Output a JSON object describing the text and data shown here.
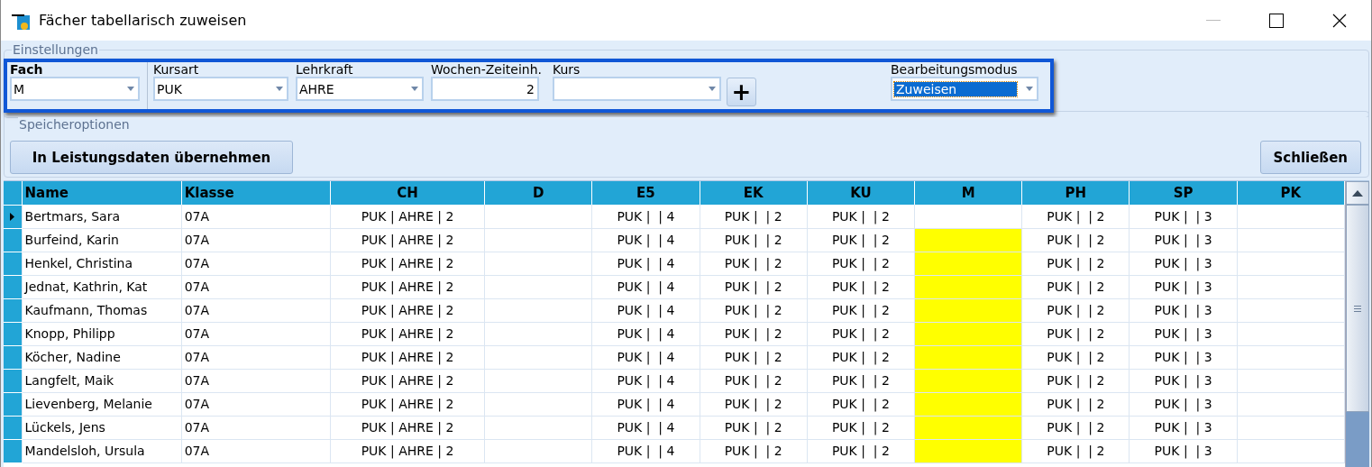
{
  "window": {
    "title": "Fächer tabellarisch zuweisen"
  },
  "settings": {
    "legend": "Einstellungen",
    "fields": [
      {
        "kind": "combo",
        "label": "Fach",
        "label_bold": true,
        "value": "M",
        "focused": false
      },
      {
        "kind": "combo",
        "label": "Kursart",
        "label_bold": false,
        "value": "PUK",
        "focused": false
      },
      {
        "kind": "combo",
        "label": "Lehrkraft",
        "label_bold": false,
        "value": "AHRE",
        "focused": false
      },
      {
        "kind": "number",
        "label": "Wochen-Zeiteinh.",
        "label_bold": false,
        "value": "2"
      },
      {
        "kind": "combo",
        "label": "Kurs",
        "label_bold": false,
        "focused": false
      },
      {
        "kind": "add",
        "label": "+"
      },
      {
        "kind": "combo",
        "label": "Bearbeitungsmodus",
        "label_bold": false,
        "value": "Zuweisen",
        "focused": true
      }
    ]
  },
  "save_options": {
    "legend": "Speicheroptionen",
    "buttons": [
      {
        "label": "In Leistungsdaten übernehmen"
      },
      {
        "label": "Schließen"
      }
    ]
  },
  "table": {
    "columns": [
      "Name",
      "Klasse",
      "CH",
      "D",
      "E5",
      "EK",
      "KU",
      "M",
      "PH",
      "SP",
      "PK"
    ],
    "rows": [
      {
        "current": true,
        "cells": [
          {
            "text": "Bertmars, Sara",
            "marked": false
          },
          {
            "text": "07A",
            "marked": false
          },
          {
            "text": "PUK | AHRE | 2",
            "marked": false
          },
          {
            "marked": false
          },
          {
            "text": "PUK |  | 4",
            "marked": false
          },
          {
            "text": "PUK |  | 2",
            "marked": false
          },
          {
            "text": "PUK |  | 2",
            "marked": false
          },
          {
            "marked": false
          },
          {
            "text": "PUK |  | 2",
            "marked": false
          },
          {
            "text": "PUK |  | 3",
            "marked": false
          },
          {
            "marked": false
          }
        ]
      },
      {
        "current": false,
        "cells": [
          {
            "text": "Burfeind, Karin",
            "marked": false
          },
          {
            "text": "07A",
            "marked": false
          },
          {
            "text": "PUK | AHRE | 2",
            "marked": false
          },
          {
            "marked": false
          },
          {
            "text": "PUK |  | 4",
            "marked": false
          },
          {
            "text": "PUK |  | 2",
            "marked": false
          },
          {
            "text": "PUK |  | 2",
            "marked": false
          },
          {
            "marked": true
          },
          {
            "text": "PUK |  | 2",
            "marked": false
          },
          {
            "text": "PUK |  | 3",
            "marked": false
          },
          {
            "marked": false
          }
        ]
      },
      {
        "current": false,
        "cells": [
          {
            "text": "Henkel, Christina",
            "marked": false
          },
          {
            "text": "07A",
            "marked": false
          },
          {
            "text": "PUK | AHRE | 2",
            "marked": false
          },
          {
            "marked": false
          },
          {
            "text": "PUK |  | 4",
            "marked": false
          },
          {
            "text": "PUK |  | 2",
            "marked": false
          },
          {
            "text": "PUK |  | 2",
            "marked": false
          },
          {
            "marked": true
          },
          {
            "text": "PUK |  | 2",
            "marked": false
          },
          {
            "text": "PUK |  | 3",
            "marked": false
          },
          {
            "marked": false
          }
        ]
      },
      {
        "current": false,
        "cells": [
          {
            "text": "Jednat, Kathrin, Kat",
            "marked": false
          },
          {
            "text": "07A",
            "marked": false
          },
          {
            "text": "PUK | AHRE | 2",
            "marked": false
          },
          {
            "marked": false
          },
          {
            "text": "PUK |  | 4",
            "marked": false
          },
          {
            "text": "PUK |  | 2",
            "marked": false
          },
          {
            "text": "PUK |  | 2",
            "marked": false
          },
          {
            "marked": true
          },
          {
            "text": "PUK |  | 2",
            "marked": false
          },
          {
            "text": "PUK |  | 3",
            "marked": false
          },
          {
            "marked": false
          }
        ]
      },
      {
        "current": false,
        "cells": [
          {
            "text": "Kaufmann, Thomas",
            "marked": false
          },
          {
            "text": "07A",
            "marked": false
          },
          {
            "text": "PUK | AHRE | 2",
            "marked": false
          },
          {
            "marked": false
          },
          {
            "text": "PUK |  | 4",
            "marked": false
          },
          {
            "text": "PUK |  | 2",
            "marked": false
          },
          {
            "text": "PUK |  | 2",
            "marked": false
          },
          {
            "marked": true
          },
          {
            "text": "PUK |  | 2",
            "marked": false
          },
          {
            "text": "PUK |  | 3",
            "marked": false
          },
          {
            "marked": false
          }
        ]
      },
      {
        "current": false,
        "cells": [
          {
            "text": "Knopp, Philipp",
            "marked": false
          },
          {
            "text": "07A",
            "marked": false
          },
          {
            "text": "PUK | AHRE | 2",
            "marked": false
          },
          {
            "marked": false
          },
          {
            "text": "PUK |  | 4",
            "marked": false
          },
          {
            "text": "PUK |  | 2",
            "marked": false
          },
          {
            "text": "PUK |  | 2",
            "marked": false
          },
          {
            "marked": true
          },
          {
            "text": "PUK |  | 2",
            "marked": false
          },
          {
            "text": "PUK |  | 3",
            "marked": false
          },
          {
            "marked": false
          }
        ]
      },
      {
        "current": false,
        "cells": [
          {
            "text": "Köcher, Nadine",
            "marked": false
          },
          {
            "text": "07A",
            "marked": false
          },
          {
            "text": "PUK | AHRE | 2",
            "marked": false
          },
          {
            "marked": false
          },
          {
            "text": "PUK |  | 4",
            "marked": false
          },
          {
            "text": "PUK |  | 2",
            "marked": false
          },
          {
            "text": "PUK |  | 2",
            "marked": false
          },
          {
            "marked": true
          },
          {
            "text": "PUK |  | 2",
            "marked": false
          },
          {
            "text": "PUK |  | 3",
            "marked": false
          },
          {
            "marked": false
          }
        ]
      },
      {
        "current": false,
        "cells": [
          {
            "text": "Langfelt, Maik",
            "marked": false
          },
          {
            "text": "07A",
            "marked": false
          },
          {
            "text": "PUK | AHRE | 2",
            "marked": false
          },
          {
            "marked": false
          },
          {
            "text": "PUK |  | 4",
            "marked": false
          },
          {
            "text": "PUK |  | 2",
            "marked": false
          },
          {
            "text": "PUK |  | 2",
            "marked": false
          },
          {
            "marked": true
          },
          {
            "text": "PUK |  | 2",
            "marked": false
          },
          {
            "text": "PUK |  | 3",
            "marked": false
          },
          {
            "marked": false
          }
        ]
      },
      {
        "current": false,
        "cells": [
          {
            "text": "Lievenberg, Melanie",
            "marked": false
          },
          {
            "text": "07A",
            "marked": false
          },
          {
            "text": "PUK | AHRE | 2",
            "marked": false
          },
          {
            "marked": false
          },
          {
            "text": "PUK |  | 4",
            "marked": false
          },
          {
            "text": "PUK |  | 2",
            "marked": false
          },
          {
            "text": "PUK |  | 2",
            "marked": false
          },
          {
            "marked": true
          },
          {
            "text": "PUK |  | 2",
            "marked": false
          },
          {
            "text": "PUK |  | 3",
            "marked": false
          },
          {
            "marked": false
          }
        ]
      },
      {
        "current": false,
        "cells": [
          {
            "text": "Lückels, Jens",
            "marked": false
          },
          {
            "text": "07A",
            "marked": false
          },
          {
            "text": "PUK | AHRE | 2",
            "marked": false
          },
          {
            "marked": false
          },
          {
            "text": "PUK |  | 4",
            "marked": false
          },
          {
            "text": "PUK |  | 2",
            "marked": false
          },
          {
            "text": "PUK |  | 2",
            "marked": false
          },
          {
            "marked": true
          },
          {
            "text": "PUK |  | 2",
            "marked": false
          },
          {
            "text": "PUK |  | 3",
            "marked": false
          },
          {
            "marked": false
          }
        ]
      },
      {
        "current": false,
        "cells": [
          {
            "text": "Mandelsloh, Ursula",
            "marked": false
          },
          {
            "text": "07A",
            "marked": false
          },
          {
            "text": "PUK | AHRE | 2",
            "marked": false
          },
          {
            "marked": false
          },
          {
            "text": "PUK |  | 4",
            "marked": false
          },
          {
            "text": "PUK |  | 2",
            "marked": false
          },
          {
            "text": "PUK |  | 2",
            "marked": false
          },
          {
            "marked": true
          },
          {
            "text": "PUK |  | 2",
            "marked": false
          },
          {
            "text": "PUK |  | 3",
            "marked": false
          },
          {
            "marked": false
          }
        ]
      }
    ]
  }
}
